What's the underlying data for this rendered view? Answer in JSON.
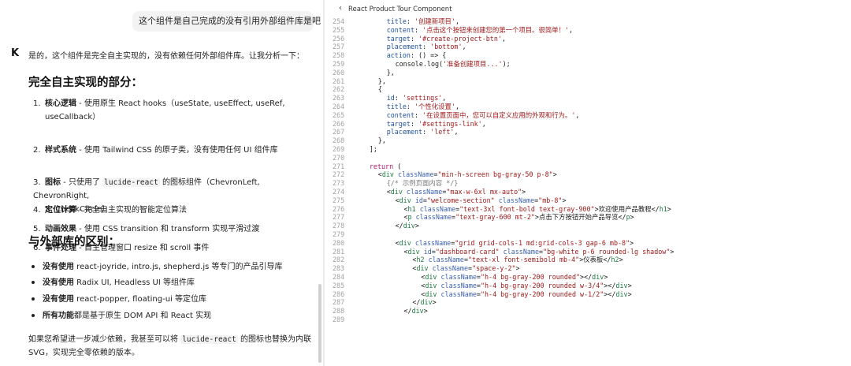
{
  "chat": {
    "user_message": "这个组件是自己完成的没有引用外部组件库是吧",
    "assistant_avatar": "K",
    "assistant_intro": "是的，这个组件是完全自主实现的，没有依赖任何外部组件库。让我分析一下：",
    "section1_title": "完全自主实现的部分：",
    "ordered_items": [
      {
        "num": "1.",
        "bold": "核心逻辑",
        "text": " - 使用原生 React hooks（useState, useEffect, useRef,",
        "cont": "useCallback）"
      },
      {
        "num": "2.",
        "bold": "样式系统",
        "text": " - 使用 Tailwind CSS 的原子类，没有使用任何 UI 组件库",
        "cont": ""
      },
      {
        "num": "3.",
        "bold": "图标",
        "text": " - 只使用了 ",
        "code": "lucide-react",
        "text2": " 的图标组件（ChevronLeft, ChevronRight,",
        "cont": "X, CheckCircle）"
      },
      {
        "num": "4.",
        "bold": "定位计算",
        "text": " - 完全自主实现的智能定位算法",
        "cont": ""
      },
      {
        "num": "5.",
        "bold": "动画效果",
        "text": " - 使用 CSS transition 和 transform 实现平滑过渡",
        "cont": ""
      },
      {
        "num": "6.",
        "bold": "事件处理",
        "text": " - 自主管理窗口 resize 和 scroll 事件",
        "cont": ""
      }
    ],
    "section2_title": "与外部库的区别：",
    "bullet_items": [
      {
        "bold": "没有使用",
        "text": " react-joyride, intro.js, shepherd.js 等专门的产品引导库"
      },
      {
        "bold": "没有使用",
        "text": " Radix UI, Headless UI 等组件库"
      },
      {
        "bold": "没有使用",
        "text": " react-popper, floating-ui 等定位库"
      },
      {
        "bold": "所有功能",
        "text": "都是基于原生 DOM API 和 React 实现"
      }
    ],
    "closing_line1_a": "如果您希望进一步减少依赖，我甚至可以将 ",
    "closing_code": "lucide-react",
    "closing_line1_b": " 的图标也替换为内联",
    "closing_line2": "SVG，实现完全零依赖的版本。"
  },
  "code_pane": {
    "title": "React Product Tour Component",
    "lines": [
      {
        "n": "254",
        "indent": 6,
        "tokens": [
          [
            "prop",
            "title"
          ],
          [
            "plain",
            ": "
          ],
          [
            "str",
            "'创建新项目'"
          ],
          [
            "plain",
            ","
          ]
        ]
      },
      {
        "n": "255",
        "indent": 6,
        "tokens": [
          [
            "prop",
            "content"
          ],
          [
            "plain",
            ": "
          ],
          [
            "str",
            "'点击这个按钮来创建您的第一个项目。很简单！'"
          ],
          [
            "plain",
            ","
          ]
        ]
      },
      {
        "n": "256",
        "indent": 6,
        "tokens": [
          [
            "prop",
            "target"
          ],
          [
            "plain",
            ": "
          ],
          [
            "str",
            "'#create-project-btn'"
          ],
          [
            "plain",
            ","
          ]
        ]
      },
      {
        "n": "257",
        "indent": 6,
        "tokens": [
          [
            "prop",
            "placement"
          ],
          [
            "plain",
            ": "
          ],
          [
            "str",
            "'bottom'"
          ],
          [
            "plain",
            ","
          ]
        ]
      },
      {
        "n": "258",
        "indent": 6,
        "tokens": [
          [
            "prop",
            "action"
          ],
          [
            "plain",
            ": () => {"
          ]
        ]
      },
      {
        "n": "259",
        "indent": 8,
        "tokens": [
          [
            "plain",
            "console.log("
          ],
          [
            "str",
            "'准备创建项目...'"
          ],
          [
            "plain",
            ");"
          ]
        ]
      },
      {
        "n": "260",
        "indent": 6,
        "tokens": [
          [
            "plain",
            "},"
          ]
        ]
      },
      {
        "n": "261",
        "indent": 4,
        "tokens": [
          [
            "plain",
            "},"
          ]
        ]
      },
      {
        "n": "262",
        "indent": 4,
        "tokens": [
          [
            "plain",
            "{"
          ]
        ]
      },
      {
        "n": "263",
        "indent": 6,
        "tokens": [
          [
            "prop",
            "id"
          ],
          [
            "plain",
            ": "
          ],
          [
            "str",
            "'settings'"
          ],
          [
            "plain",
            ","
          ]
        ]
      },
      {
        "n": "264",
        "indent": 6,
        "tokens": [
          [
            "prop",
            "title"
          ],
          [
            "plain",
            ": "
          ],
          [
            "str",
            "'个性化设置'"
          ],
          [
            "plain",
            ","
          ]
        ]
      },
      {
        "n": "265",
        "indent": 6,
        "tokens": [
          [
            "prop",
            "content"
          ],
          [
            "plain",
            ": "
          ],
          [
            "str",
            "'在设置页面中，您可以自定义应用的外观和行为。'"
          ],
          [
            "plain",
            ","
          ]
        ]
      },
      {
        "n": "266",
        "indent": 6,
        "tokens": [
          [
            "prop",
            "target"
          ],
          [
            "plain",
            ": "
          ],
          [
            "str",
            "'#settings-link'"
          ],
          [
            "plain",
            ","
          ]
        ]
      },
      {
        "n": "267",
        "indent": 6,
        "tokens": [
          [
            "prop",
            "placement"
          ],
          [
            "plain",
            ": "
          ],
          [
            "str",
            "'left'"
          ],
          [
            "plain",
            ","
          ]
        ]
      },
      {
        "n": "268",
        "indent": 4,
        "tokens": [
          [
            "plain",
            "},"
          ]
        ]
      },
      {
        "n": "269",
        "indent": 2,
        "tokens": [
          [
            "plain",
            "];"
          ]
        ]
      },
      {
        "n": "270",
        "indent": 0,
        "tokens": []
      },
      {
        "n": "271",
        "indent": 2,
        "tokens": [
          [
            "kw",
            "return"
          ],
          [
            "plain",
            " ("
          ]
        ]
      },
      {
        "n": "272",
        "indent": 4,
        "tokens": [
          [
            "plain",
            "<"
          ],
          [
            "tag",
            "div"
          ],
          [
            "plain",
            " "
          ],
          [
            "attr",
            "className"
          ],
          [
            "plain",
            "="
          ],
          [
            "str",
            "\"min-h-screen bg-gray-50 p-8\""
          ],
          [
            "plain",
            ">"
          ]
        ]
      },
      {
        "n": "273",
        "indent": 6,
        "tokens": [
          [
            "comment",
            "{/* 示例页面内容 */}"
          ]
        ]
      },
      {
        "n": "274",
        "indent": 6,
        "tokens": [
          [
            "plain",
            "<"
          ],
          [
            "tag",
            "div"
          ],
          [
            "plain",
            " "
          ],
          [
            "attr",
            "className"
          ],
          [
            "plain",
            "="
          ],
          [
            "str",
            "\"max-w-6xl mx-auto\""
          ],
          [
            "plain",
            ">"
          ]
        ]
      },
      {
        "n": "275",
        "indent": 8,
        "tokens": [
          [
            "plain",
            "<"
          ],
          [
            "tag",
            "div"
          ],
          [
            "plain",
            " "
          ],
          [
            "attr",
            "id"
          ],
          [
            "plain",
            "="
          ],
          [
            "str",
            "\"welcome-section\""
          ],
          [
            "plain",
            " "
          ],
          [
            "attr",
            "className"
          ],
          [
            "plain",
            "="
          ],
          [
            "str",
            "\"mb-8\""
          ],
          [
            "plain",
            ">"
          ]
        ]
      },
      {
        "n": "276",
        "indent": 10,
        "tokens": [
          [
            "plain",
            "<"
          ],
          [
            "tag",
            "h1"
          ],
          [
            "plain",
            " "
          ],
          [
            "attr",
            "className"
          ],
          [
            "plain",
            "="
          ],
          [
            "str",
            "\"text-3xl font-bold text-gray-900\""
          ],
          [
            "plain",
            ">欢迎使用产品教程</"
          ],
          [
            "tag",
            "h1"
          ],
          [
            "plain",
            ">"
          ]
        ]
      },
      {
        "n": "277",
        "indent": 10,
        "tokens": [
          [
            "plain",
            "<"
          ],
          [
            "tag",
            "p"
          ],
          [
            "plain",
            " "
          ],
          [
            "attr",
            "className"
          ],
          [
            "plain",
            "="
          ],
          [
            "str",
            "\"text-gray-600 mt-2\""
          ],
          [
            "plain",
            ">点击下方按钮开始产品导览</"
          ],
          [
            "tag",
            "p"
          ],
          [
            "plain",
            ">"
          ]
        ]
      },
      {
        "n": "278",
        "indent": 8,
        "tokens": [
          [
            "plain",
            "</"
          ],
          [
            "tag",
            "div"
          ],
          [
            "plain",
            ">"
          ]
        ]
      },
      {
        "n": "279",
        "indent": 0,
        "tokens": []
      },
      {
        "n": "280",
        "indent": 8,
        "tokens": [
          [
            "plain",
            "<"
          ],
          [
            "tag",
            "div"
          ],
          [
            "plain",
            " "
          ],
          [
            "attr",
            "className"
          ],
          [
            "plain",
            "="
          ],
          [
            "str",
            "\"grid grid-cols-1 md:grid-cols-3 gap-6 mb-8\""
          ],
          [
            "plain",
            ">"
          ]
        ]
      },
      {
        "n": "281",
        "indent": 10,
        "tokens": [
          [
            "plain",
            "<"
          ],
          [
            "tag",
            "div"
          ],
          [
            "plain",
            " "
          ],
          [
            "attr",
            "id"
          ],
          [
            "plain",
            "="
          ],
          [
            "str",
            "\"dashboard-card\""
          ],
          [
            "plain",
            " "
          ],
          [
            "attr",
            "className"
          ],
          [
            "plain",
            "="
          ],
          [
            "str",
            "\"bg-white p-6 rounded-lg shadow\""
          ],
          [
            "plain",
            ">"
          ]
        ]
      },
      {
        "n": "282",
        "indent": 12,
        "tokens": [
          [
            "plain",
            "<"
          ],
          [
            "tag",
            "h2"
          ],
          [
            "plain",
            " "
          ],
          [
            "attr",
            "className"
          ],
          [
            "plain",
            "="
          ],
          [
            "str",
            "\"text-xl font-semibold mb-4\""
          ],
          [
            "plain",
            ">仪表板</"
          ],
          [
            "tag",
            "h2"
          ],
          [
            "plain",
            ">"
          ]
        ]
      },
      {
        "n": "283",
        "indent": 12,
        "tokens": [
          [
            "plain",
            "<"
          ],
          [
            "tag",
            "div"
          ],
          [
            "plain",
            " "
          ],
          [
            "attr",
            "className"
          ],
          [
            "plain",
            "="
          ],
          [
            "str",
            "\"space-y-2\""
          ],
          [
            "plain",
            ">"
          ]
        ]
      },
      {
        "n": "284",
        "indent": 14,
        "tokens": [
          [
            "plain",
            "<"
          ],
          [
            "tag",
            "div"
          ],
          [
            "plain",
            " "
          ],
          [
            "attr",
            "className"
          ],
          [
            "plain",
            "="
          ],
          [
            "str",
            "\"h-4 bg-gray-200 rounded\""
          ],
          [
            "plain",
            "></"
          ],
          [
            "tag",
            "div"
          ],
          [
            "plain",
            ">"
          ]
        ]
      },
      {
        "n": "285",
        "indent": 14,
        "tokens": [
          [
            "plain",
            "<"
          ],
          [
            "tag",
            "div"
          ],
          [
            "plain",
            " "
          ],
          [
            "attr",
            "className"
          ],
          [
            "plain",
            "="
          ],
          [
            "str",
            "\"h-4 bg-gray-200 rounded w-3/4\""
          ],
          [
            "plain",
            "></"
          ],
          [
            "tag",
            "div"
          ],
          [
            "plain",
            ">"
          ]
        ]
      },
      {
        "n": "286",
        "indent": 14,
        "tokens": [
          [
            "plain",
            "<"
          ],
          [
            "tag",
            "div"
          ],
          [
            "plain",
            " "
          ],
          [
            "attr",
            "className"
          ],
          [
            "plain",
            "="
          ],
          [
            "str",
            "\"h-4 bg-gray-200 rounded w-1/2\""
          ],
          [
            "plain",
            "></"
          ],
          [
            "tag",
            "div"
          ],
          [
            "plain",
            ">"
          ]
        ]
      },
      {
        "n": "287",
        "indent": 12,
        "tokens": [
          [
            "plain",
            "</"
          ],
          [
            "tag",
            "div"
          ],
          [
            "plain",
            ">"
          ]
        ]
      },
      {
        "n": "288",
        "indent": 10,
        "tokens": [
          [
            "plain",
            "</"
          ],
          [
            "tag",
            "div"
          ],
          [
            "plain",
            ">"
          ]
        ]
      },
      {
        "n": "289",
        "indent": 0,
        "tokens": []
      }
    ]
  },
  "colors": {
    "prop": "#1e4f9c",
    "string": "#a11a1a",
    "keyword": "#b01670",
    "tag": "#1a7a3d",
    "attribute": "#3a5fb0",
    "comment": "#7b7b7b"
  },
  "icons": {
    "back": "chevron-left-icon"
  }
}
